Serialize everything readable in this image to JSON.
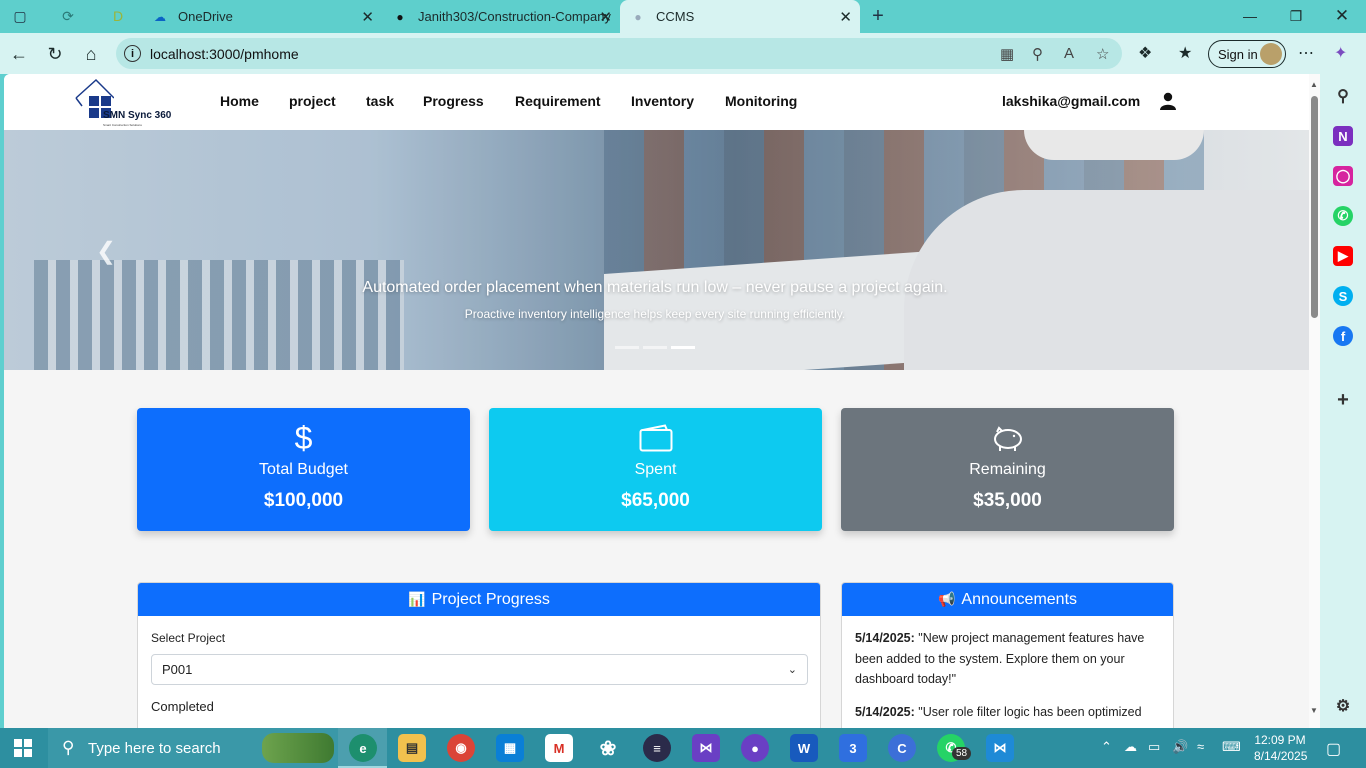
{
  "browser": {
    "tabs": [
      {
        "title": "OneDrive",
        "active": false
      },
      {
        "title": "Janith303/Construction-Company",
        "active": false
      },
      {
        "title": "CCMS",
        "active": true
      }
    ],
    "url": "localhost:3000/pmhome",
    "sign_in_label": "Sign in"
  },
  "navbar": {
    "brand": "SMN Sync 360",
    "tagline": "Smart Construction Solutions",
    "menu": [
      "Home",
      "project",
      "task",
      "Progress",
      "Requirement",
      "Inventory",
      "Monitoring"
    ],
    "user_email": "lakshika@gmail.com"
  },
  "hero": {
    "caption": "Automated order placement when materials run low – never pause a project again.",
    "subcaption": "Proactive inventory intelligence helps keep every site running efficiently.",
    "slide_count": 3,
    "active_slide": 3
  },
  "summary": [
    {
      "label": "Total Budget",
      "value": "$100,000",
      "icon": "dollar-icon",
      "color": "#0d6efd"
    },
    {
      "label": "Spent",
      "value": "$65,000",
      "icon": "wallet-icon",
      "color": "#0dcaf0"
    },
    {
      "label": "Remaining",
      "value": "$35,000",
      "icon": "piggy-bank-icon",
      "color": "#6c757d"
    }
  ],
  "progress_panel": {
    "title": "Project Progress",
    "select_label": "Select Project",
    "selected_project": "P001",
    "status_label": "Completed"
  },
  "announcements_panel": {
    "title": "Announcements",
    "items": [
      {
        "date": "5/14/2025:",
        "text": "\"New project management features have been added to the system. Explore them on your dashboard today!\""
      },
      {
        "date": "5/14/2025:",
        "text": "\"User role filter logic has been optimized"
      }
    ]
  },
  "taskbar": {
    "search_placeholder": "Type here to search",
    "time": "12:09 PM",
    "date": "8/14/2025",
    "whatsapp_badge": "58"
  }
}
